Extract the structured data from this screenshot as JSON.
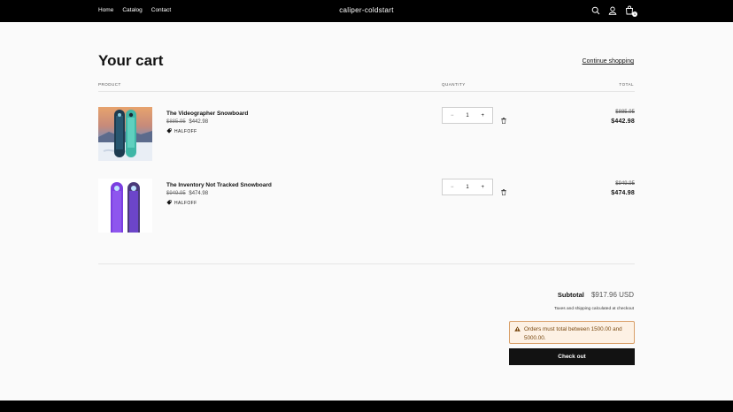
{
  "header": {
    "nav": [
      "Home",
      "Catalog",
      "Contact"
    ],
    "brand": "caliper-coldstart",
    "cart_count": "1"
  },
  "cart": {
    "title": "Your cart",
    "continue_label": "Continue shopping",
    "col_product": "PRODUCT",
    "col_quantity": "QUANTITY",
    "col_total": "TOTAL",
    "items": [
      {
        "name": "The Videographer Snowboard",
        "old_price": "$885.95",
        "price": "$442.98",
        "discount": "HALFOFF",
        "quantity": "1",
        "total_old": "$885.95",
        "total": "$442.98"
      },
      {
        "name": "The Inventory Not Tracked Snowboard",
        "old_price": "$949.95",
        "price": "$474.98",
        "discount": "HALFOFF",
        "quantity": "1",
        "total_old": "$949.95",
        "total": "$474.98"
      }
    ],
    "subtotal_label": "Subtotal",
    "subtotal_value": "$917.96 USD",
    "taxes_note": "Taxes and shipping calculated at checkout",
    "warning": "Orders must total between 1500.00 and 5000.00.",
    "checkout_label": "Check out"
  },
  "colors": {
    "header_bg": "#000000",
    "page_bg": "#fafafa",
    "warning_bg": "#fdf1e4",
    "warning_border": "#d9a06a",
    "button_bg": "#121212"
  },
  "icons": [
    "search-icon",
    "account-icon",
    "cart-icon",
    "minus-icon",
    "plus-icon",
    "trash-icon",
    "tag-icon",
    "warning-icon"
  ]
}
